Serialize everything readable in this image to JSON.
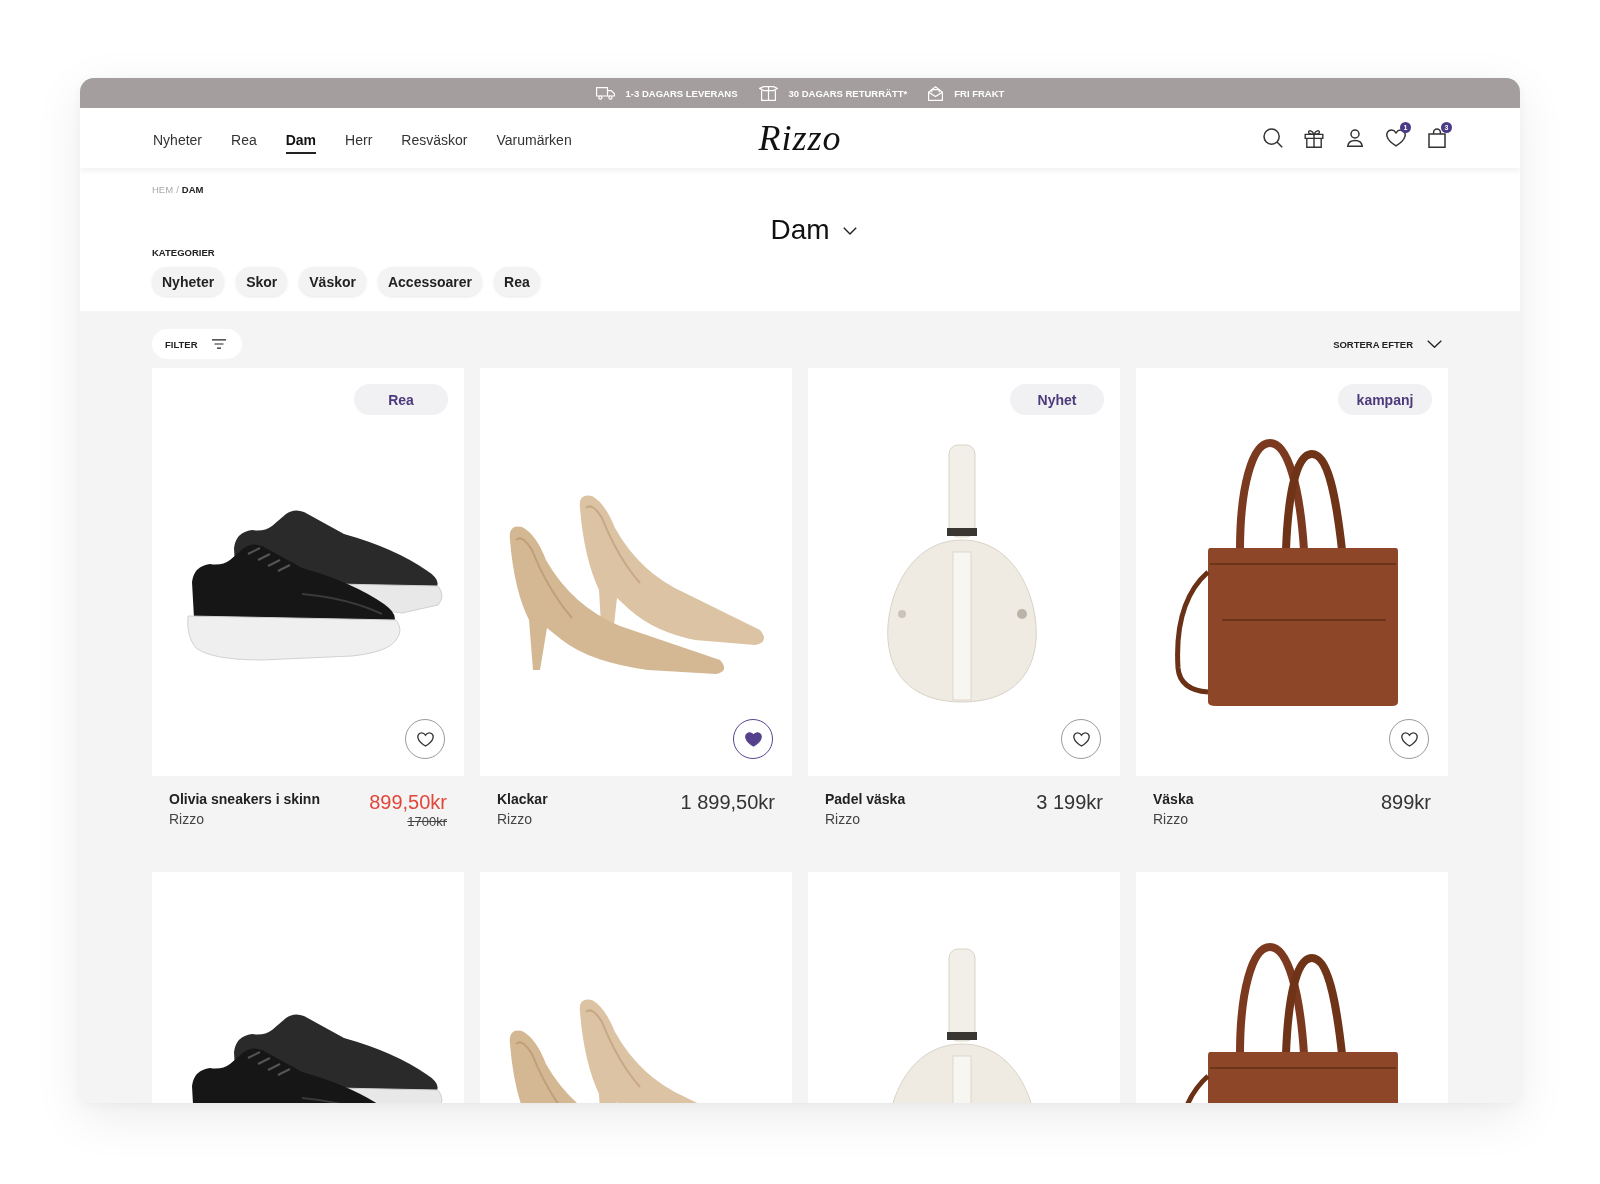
{
  "promo_bar": {
    "items": [
      {
        "kind": "delivery",
        "text": "1-3 DAGARS LEVERANS"
      },
      {
        "kind": "returns",
        "text": "30 DAGARS RETURRÄTT*"
      },
      {
        "kind": "shipping",
        "text": "FRI FRAKT"
      }
    ]
  },
  "nav": {
    "links": [
      {
        "label": "Nyheter",
        "selected": false
      },
      {
        "label": "Rea",
        "selected": false
      },
      {
        "label": "Dam",
        "selected": true
      },
      {
        "label": "Herr",
        "selected": false
      },
      {
        "label": "Resväskor",
        "selected": false
      },
      {
        "label": "Varumärken",
        "selected": false
      }
    ],
    "logo": "Rizzo",
    "icons": [
      {
        "kind": "search"
      },
      {
        "kind": "gift"
      },
      {
        "kind": "account"
      },
      {
        "kind": "wishlist",
        "count": "1"
      },
      {
        "kind": "cart",
        "count": "3"
      }
    ]
  },
  "breadcrumb": {
    "separator": "/",
    "items": [
      {
        "label": "HEM",
        "current": false
      },
      {
        "label": "DAM",
        "current": true
      }
    ]
  },
  "title": "Dam",
  "categories": {
    "label": "KATEGORIER",
    "items": [
      "Nyheter",
      "Skor",
      "Väskor",
      "Accessoarer",
      "Rea"
    ]
  },
  "toolbar": {
    "filter": "FILTER",
    "sort": "SORTERA EFTER"
  },
  "products": [
    {
      "kind": "sneaker",
      "badge": "Rea",
      "favorite": false,
      "name": "Olivia sneakers i skinn",
      "brand": "Rizzo",
      "price": "899,50kr",
      "old_price": "1700kr",
      "sale": true
    },
    {
      "kind": "pumps",
      "favorite": true,
      "name": "Klackar",
      "brand": "Rizzo",
      "price": "1 899,50kr",
      "sale": false
    },
    {
      "kind": "padel_bag",
      "badge": "Nyhet",
      "favorite": false,
      "name": "Padel väska",
      "brand": "Rizzo",
      "price": "3 199kr",
      "sale": false
    },
    {
      "kind": "tote",
      "badge": "kampanj",
      "favorite": false,
      "name": "Väska",
      "brand": "Rizzo",
      "price": "899kr",
      "sale": false
    },
    {
      "kind": "sneaker"
    },
    {
      "kind": "pumps"
    },
    {
      "kind": "padel_bag"
    },
    {
      "kind": "tote"
    }
  ]
}
